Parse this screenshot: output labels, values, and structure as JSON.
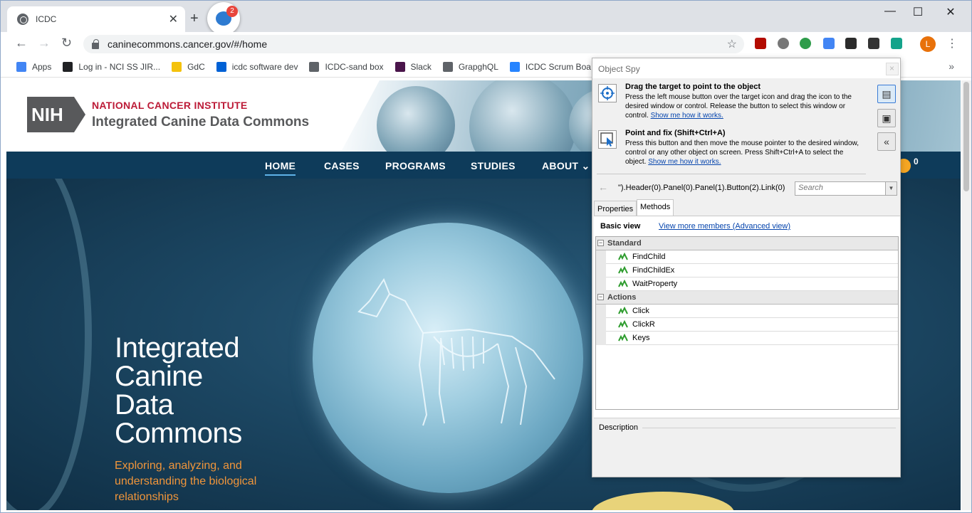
{
  "browser": {
    "tab": {
      "title": "ICDC",
      "close": "✕"
    },
    "new_tab": "+",
    "extension_badge": "2",
    "window_controls": {
      "minimize": "—",
      "maximize": "☐",
      "close": "✕"
    },
    "nav": {
      "back": "←",
      "forward": "→",
      "reload": "↻"
    },
    "address": "caninecommons.cancer.gov/#/home",
    "star": "☆",
    "profile_initial": "L",
    "menu": "⋮",
    "bookmarks": [
      {
        "label": "Apps",
        "icon": "apps-grid-icon",
        "color": "#4285f4"
      },
      {
        "label": "Log in - NCI SS JIR...",
        "icon": "jira-icon",
        "color": "#202124"
      },
      {
        "label": "GdC",
        "icon": "folder-icon",
        "color": "#f4c20d"
      },
      {
        "label": "icdc software dev",
        "icon": "box-icon",
        "color": "#0061d5"
      },
      {
        "label": "ICDC-sand box",
        "icon": "globe-icon",
        "color": "#5f6368"
      },
      {
        "label": "Slack",
        "icon": "slack-icon",
        "color": "#4a154b"
      },
      {
        "label": "GrapghQL",
        "icon": "globe-icon",
        "color": "#5f6368"
      },
      {
        "label": "ICDC Scrum Boa",
        "icon": "jira-diamond-icon",
        "color": "#2684ff"
      }
    ],
    "bookmarks_more": "»"
  },
  "site": {
    "logo_text": "NIH",
    "institute": "NATIONAL CANCER INSTITUTE",
    "name": "Integrated Canine Data Commons",
    "nav": [
      "HOME",
      "CASES",
      "PROGRAMS",
      "STUDIES",
      "ABOUT ⌄"
    ],
    "cart_count": "0",
    "hero_title": [
      "Integrated",
      "Canine",
      "Data",
      "Commons"
    ],
    "hero_subtitle": "Exploring, analyzing, and understanding the biological relationships"
  },
  "object_spy": {
    "title": "Object Spy",
    "drag": {
      "heading": "Drag the target to point to the object",
      "text": "Press the left mouse button over the target icon and drag the icon to the desired window or control. Release the button to select this window or control. ",
      "link": "Show me how it works."
    },
    "point": {
      "heading": "Point and fix (Shift+Ctrl+A)",
      "text": "Press this button and then move the mouse pointer to the desired window, control or any other object on screen. Press Shift+Ctrl+A to select the object. ",
      "link": "Show me how it works."
    },
    "collapse": "«",
    "path": "\").Header(0).Panel(0).Panel(1).Button(2).Link(0)",
    "search_placeholder": "Search",
    "tabs": [
      "Properties",
      "Methods"
    ],
    "active_tab": "Methods",
    "basic_view": "Basic view",
    "advanced_link": "View more members (Advanced view)",
    "groups": [
      {
        "name": "Standard",
        "items": [
          "FindChild",
          "FindChildEx",
          "WaitProperty"
        ]
      },
      {
        "name": "Actions",
        "items": [
          "Click",
          "ClickR",
          "Keys"
        ]
      }
    ],
    "description_label": "Description"
  }
}
